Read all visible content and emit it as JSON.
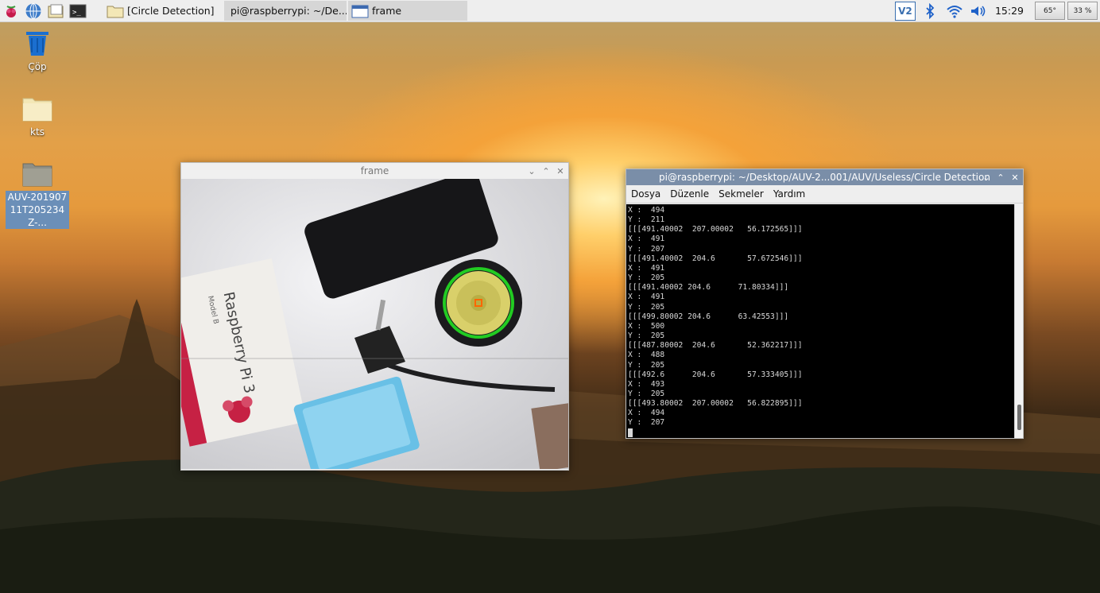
{
  "taskbar": {
    "launchers": [
      "raspberry-menu-icon",
      "web-browser-icon",
      "file-manager-icon",
      "terminal-icon"
    ],
    "tasks": [
      {
        "label": "[Circle Detection]",
        "icon": "folder-icon"
      },
      {
        "label": "pi@raspberrypi: ~/De...",
        "icon": "terminal-icon"
      },
      {
        "label": "frame",
        "icon": "window-icon"
      }
    ],
    "vnc_label": "V2",
    "clock": "15:29",
    "cpu_temp": "65°",
    "cpu_usage": "33 %"
  },
  "desktop": {
    "icons": [
      {
        "label": "Çöp",
        "icon": "trash-icon"
      },
      {
        "label": "kts",
        "icon": "folder-icon"
      },
      {
        "label": "AUV-20190711T205234Z-...",
        "icon": "folder-icon"
      }
    ],
    "colors": {
      "trash": "#1a6fd0",
      "folder": "#f3e7b6"
    }
  },
  "frame_window": {
    "title": "frame",
    "image_labels": {
      "box_brand": "Raspberry Pi 3",
      "box_sub": "Model B"
    },
    "colors": {
      "detection_circle": "#22cc22",
      "center_marker": "#ff6600"
    }
  },
  "terminal_window": {
    "title": "pi@raspberrypi: ~/Desktop/AUV-2...001/AUV/Useless/Circle Detection",
    "menu": [
      "Dosya",
      "Düzenle",
      "Sekmeler",
      "Yardım"
    ],
    "lines": [
      "X :  494",
      "Y :  211",
      "[[[491.40002  207.00002   56.172565]]]",
      "X :  491",
      "Y :  207",
      "[[[491.40002  204.6       57.672546]]]",
      "X :  491",
      "Y :  205",
      "[[[491.40002 204.6      71.80334]]]",
      "X :  491",
      "Y :  205",
      "[[[499.80002 204.6      63.42553]]]",
      "X :  500",
      "Y :  205",
      "[[[487.80002  204.6       52.362217]]]",
      "X :  488",
      "Y :  205",
      "[[[492.6      204.6       57.333405]]]",
      "X :  493",
      "Y :  205",
      "[[[493.80002  207.00002   56.822895]]]",
      "X :  494",
      "Y :  207"
    ]
  }
}
